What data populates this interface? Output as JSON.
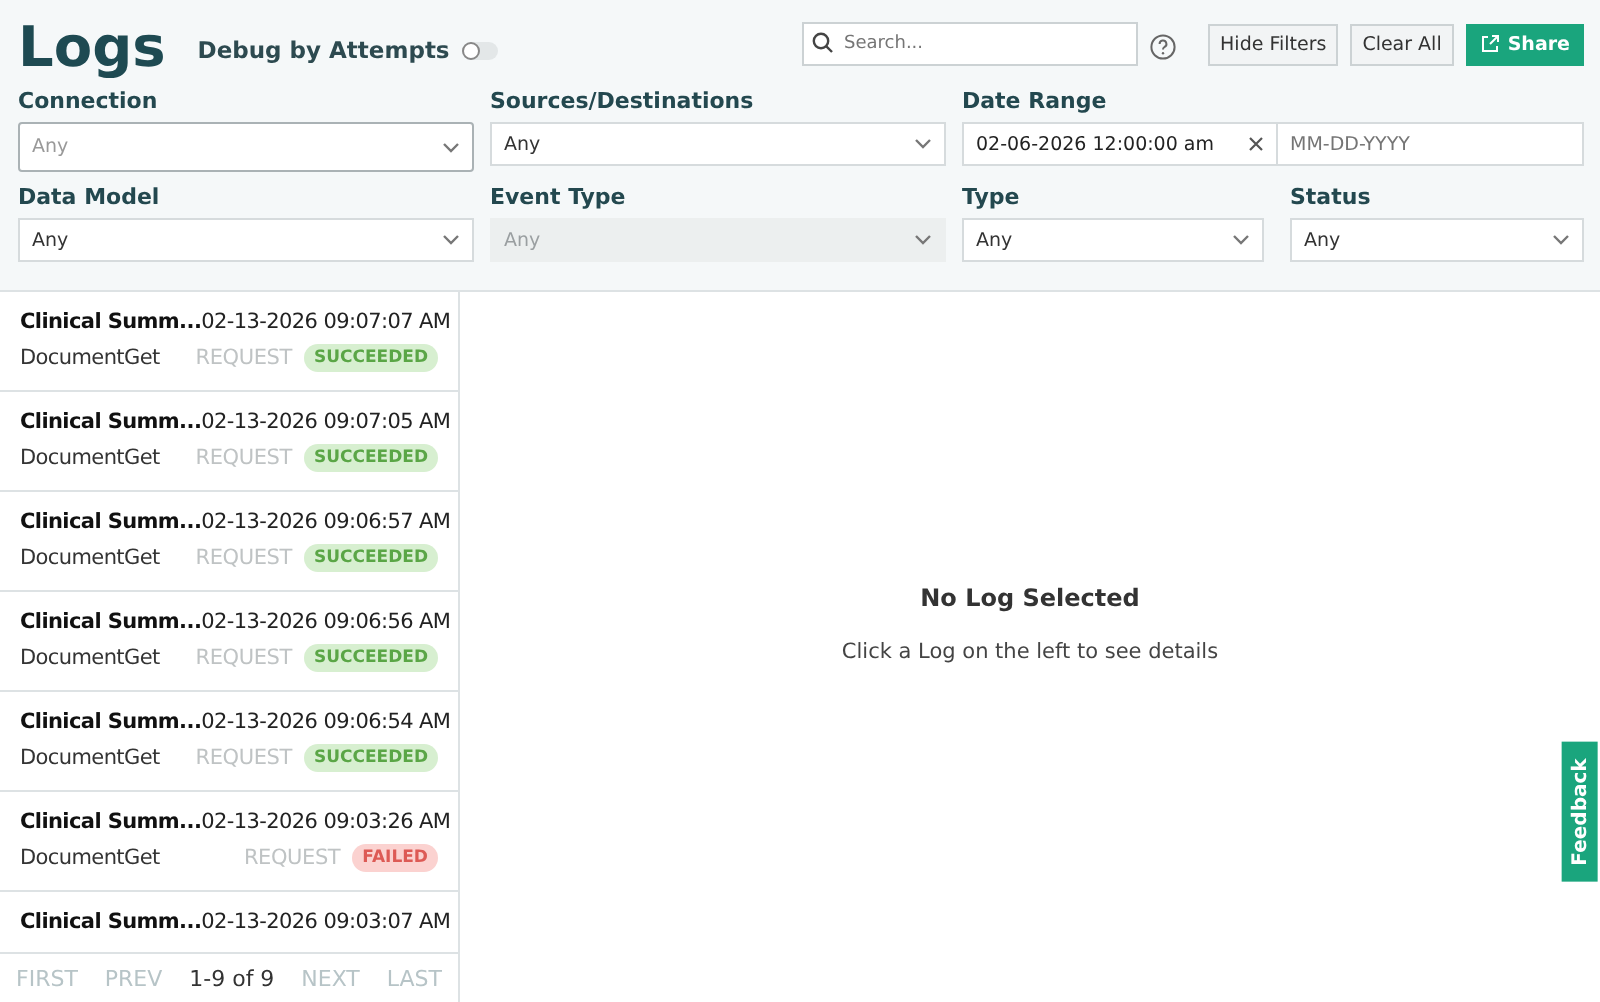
{
  "page_title": "Logs",
  "debug_toggle": {
    "label": "Debug by Attempts",
    "on": false
  },
  "search": {
    "placeholder": "Search..."
  },
  "actions": [
    {
      "label": "Hide Filters",
      "kind": "plain"
    },
    {
      "label": "Clear All",
      "kind": "plain"
    },
    {
      "label": "Share",
      "kind": "primary"
    }
  ],
  "filters": [
    {
      "label": "Connection",
      "value": "Any",
      "disabled": false,
      "focused": true
    },
    {
      "label": "Sources/Destinations",
      "value": "Any",
      "disabled": false,
      "focused": false
    },
    {
      "label": "Data Model",
      "value": "Any",
      "disabled": false,
      "focused": false
    },
    {
      "label": "Event Type",
      "value": "Any",
      "disabled": true,
      "focused": false
    },
    {
      "label": "Type",
      "value": "Any",
      "disabled": false,
      "focused": false
    },
    {
      "label": "Status",
      "value": "Any",
      "disabled": false,
      "focused": false
    }
  ],
  "date_range": {
    "label": "Date Range",
    "start": "02-06-2026 12:00:00 am",
    "end_placeholder": "MM-DD-YYYY"
  },
  "logs": [
    {
      "name": "Clinical Summ...",
      "time": "02-13-2026 09:07:07 AM",
      "event": "DocumentGet",
      "type": "REQUEST",
      "status": "SUCCEEDED",
      "kind": "success"
    },
    {
      "name": "Clinical Summ...",
      "time": "02-13-2026 09:07:05 AM",
      "event": "DocumentGet",
      "type": "REQUEST",
      "status": "SUCCEEDED",
      "kind": "success"
    },
    {
      "name": "Clinical Summ...",
      "time": "02-13-2026 09:06:57 AM",
      "event": "DocumentGet",
      "type": "REQUEST",
      "status": "SUCCEEDED",
      "kind": "success"
    },
    {
      "name": "Clinical Summ...",
      "time": "02-13-2026 09:06:56 AM",
      "event": "DocumentGet",
      "type": "REQUEST",
      "status": "SUCCEEDED",
      "kind": "success"
    },
    {
      "name": "Clinical Summ...",
      "time": "02-13-2026 09:06:54 AM",
      "event": "DocumentGet",
      "type": "REQUEST",
      "status": "SUCCEEDED",
      "kind": "success"
    },
    {
      "name": "Clinical Summ...",
      "time": "02-13-2026 09:03:26 AM",
      "event": "DocumentGet",
      "type": "REQUEST",
      "status": "FAILED",
      "kind": "failed"
    },
    {
      "name": "Clinical Summ...",
      "time": "02-13-2026 09:03:07 AM"
    }
  ],
  "pagination": {
    "first": "FIRST",
    "prev": "PREV",
    "range": "1-9 of 9",
    "next": "NEXT",
    "last": "LAST"
  },
  "empty_state": {
    "title": "No Log Selected",
    "hint": "Click a Log on the left to see details"
  },
  "feedback_tab": "Feedback"
}
